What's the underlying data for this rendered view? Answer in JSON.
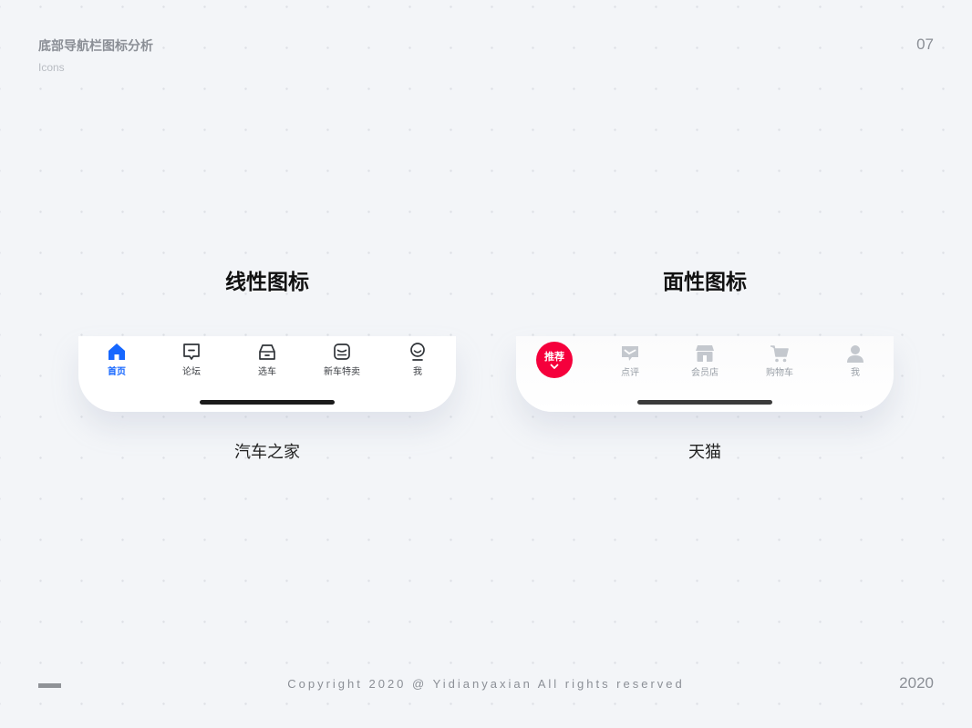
{
  "header": {
    "title": "底部导航栏图标分析",
    "subtitle": "Icons",
    "page_number": "07"
  },
  "linear": {
    "title": "线性图标",
    "caption": "汽车之家",
    "tabs": [
      {
        "label": "首页",
        "icon": "home-icon",
        "active": true
      },
      {
        "label": "论坛",
        "icon": "forum-icon"
      },
      {
        "label": "选车",
        "icon": "car-icon"
      },
      {
        "label": "新车特卖",
        "icon": "new-car-sale-icon"
      },
      {
        "label": "我",
        "icon": "profile-icon"
      }
    ]
  },
  "face": {
    "title": "面性图标",
    "caption": "天猫",
    "recommend_label": "推荐",
    "tabs": [
      {
        "label": "点评",
        "icon": "review-icon"
      },
      {
        "label": "会员店",
        "icon": "store-icon"
      },
      {
        "label": "购物车",
        "icon": "cart-icon"
      },
      {
        "label": "我",
        "icon": "user-icon"
      }
    ]
  },
  "footer": {
    "copyright": "Copyright 2020 @ Yidianyaxian All rights reserved",
    "year": "2020"
  },
  "colors": {
    "active_blue": "#1667ff",
    "tmall_red": "#f5003c",
    "inactive_gray": "#c4c8ce"
  }
}
